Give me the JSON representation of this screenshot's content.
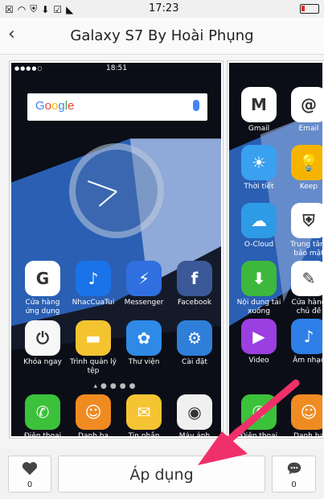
{
  "status_bar": {
    "time": "17:23"
  },
  "header": {
    "title": "Galaxy S7 By Hoài Phụng"
  },
  "phone1": {
    "time": "18:51",
    "search_logo": "Google",
    "apps_row1": [
      {
        "label": "Cửa hàng ứng dụng",
        "icon": "galaxy-store-icon",
        "color": "#ffffff",
        "glyph": "G"
      },
      {
        "label": "NhacCuaTui",
        "icon": "nhaccuatui-icon",
        "color": "#1a73e8",
        "glyph": "♪"
      },
      {
        "label": "Messenger",
        "icon": "messenger-icon",
        "color": "#2f6fe0",
        "glyph": "⚡"
      },
      {
        "label": "Facebook",
        "icon": "facebook-icon",
        "color": "#3b5998",
        "glyph": "f"
      }
    ],
    "apps_row2": [
      {
        "label": "Khóa ngay",
        "icon": "power-icon",
        "color": "#f7f7f7",
        "glyph": "⏻"
      },
      {
        "label": "Trình quản lý tệp",
        "icon": "folder-icon",
        "color": "#f4c430",
        "glyph": "▬"
      },
      {
        "label": "Thư viện",
        "icon": "gallery-icon",
        "color": "#2e8ae6",
        "glyph": "✿"
      },
      {
        "label": "Cài đặt",
        "icon": "settings-gear-icon",
        "color": "#2f7ed8",
        "glyph": "⚙"
      }
    ],
    "dock": [
      {
        "label": "Điện thoại",
        "icon": "phone-icon",
        "color": "#3cc13b",
        "glyph": "✆"
      },
      {
        "label": "Danh bạ",
        "icon": "contacts-icon",
        "color": "#f08b22",
        "glyph": "☺"
      },
      {
        "label": "Tin nhắn",
        "icon": "messages-icon",
        "color": "#f5c433",
        "glyph": "✉"
      },
      {
        "label": "Máy ảnh",
        "icon": "camera-icon",
        "color": "#f0f0f0",
        "glyph": "◉"
      }
    ]
  },
  "phone2": {
    "apps": [
      {
        "label": "Gmail",
        "icon": "gmail-icon",
        "color": "#ffffff",
        "glyph": "M"
      },
      {
        "label": "Email",
        "icon": "email-icon",
        "color": "#ffffff",
        "glyph": "@"
      },
      {
        "label": "Thời tiết",
        "icon": "weather-icon",
        "color": "#3aa0f0",
        "glyph": "☀"
      },
      {
        "label": "Keep",
        "icon": "keep-icon",
        "color": "#f6b400",
        "glyph": "💡"
      },
      {
        "label": "O-Cloud",
        "icon": "cloud-icon",
        "color": "#2e9be6",
        "glyph": "☁"
      },
      {
        "label": "Trung tâm bảo mật",
        "icon": "security-shield-icon",
        "color": "#ffffff",
        "glyph": "⛨"
      },
      {
        "label": "Nội dung tải xuống",
        "icon": "download-icon",
        "color": "#3db83d",
        "glyph": "⬇"
      },
      {
        "label": "Cửa hàng chủ đề",
        "icon": "theme-brush-icon",
        "color": "#ffffff",
        "glyph": "✎"
      },
      {
        "label": "Video",
        "icon": "video-play-icon",
        "color": "#9b3fe0",
        "glyph": "▶"
      },
      {
        "label": "Âm nhạc",
        "icon": "music-icon",
        "color": "#2e7fe8",
        "glyph": "♪"
      }
    ],
    "dock": [
      {
        "label": "Điện thoại",
        "icon": "phone-icon",
        "color": "#3cc13b",
        "glyph": "✆"
      },
      {
        "label": "Danh bạ",
        "icon": "contacts-icon",
        "color": "#f08b22",
        "glyph": "☺"
      }
    ]
  },
  "bottom": {
    "like_count": "0",
    "apply_label": "Áp dụng",
    "comment_count": "0"
  }
}
